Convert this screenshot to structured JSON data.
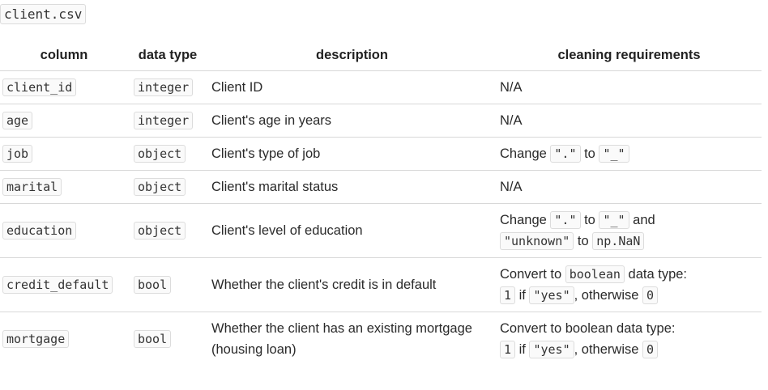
{
  "file": {
    "name": "client.csv"
  },
  "table": {
    "headers": [
      "column",
      "data type",
      "description",
      "cleaning requirements"
    ],
    "rows": [
      {
        "column": "client_id",
        "dtype": "integer",
        "description": "Client ID",
        "req_text": "N/A"
      },
      {
        "column": "age",
        "dtype": "integer",
        "description": "Client's age in years",
        "req_text": "N/A"
      },
      {
        "column": "job",
        "dtype": "object",
        "description": "Client's type of job",
        "req": {
          "w1": "Change",
          "c1": "\".\"",
          "w2": "to",
          "c2": "\"_\""
        }
      },
      {
        "column": "marital",
        "dtype": "object",
        "description": "Client's marital status",
        "req_text": "N/A"
      },
      {
        "column": "education",
        "dtype": "object",
        "description": "Client's level of education",
        "req": {
          "w1": "Change",
          "c1": "\".\"",
          "w2": "to",
          "c2": "\"_\"",
          "w3": "and",
          "c3": "\"unknown\"",
          "w4": "to",
          "c4": "np.NaN"
        }
      },
      {
        "column": "credit_default",
        "dtype": "bool",
        "description": "Whether the client's credit is in default",
        "req": {
          "w1": "Convert to",
          "c1": "boolean",
          "w2": "data type:",
          "c2": "1",
          "w3": "if",
          "c3": "\"yes\"",
          "w4": ", otherwise",
          "c4": "0"
        }
      },
      {
        "column": "mortgage",
        "dtype": "bool",
        "description": "Whether the client has an existing mortgage (housing loan)",
        "req": {
          "w1": "Convert to boolean data type:",
          "c1": "1",
          "w2": "if",
          "c2": "\"yes\"",
          "w3": ", otherwise",
          "c3": "0"
        }
      }
    ]
  }
}
